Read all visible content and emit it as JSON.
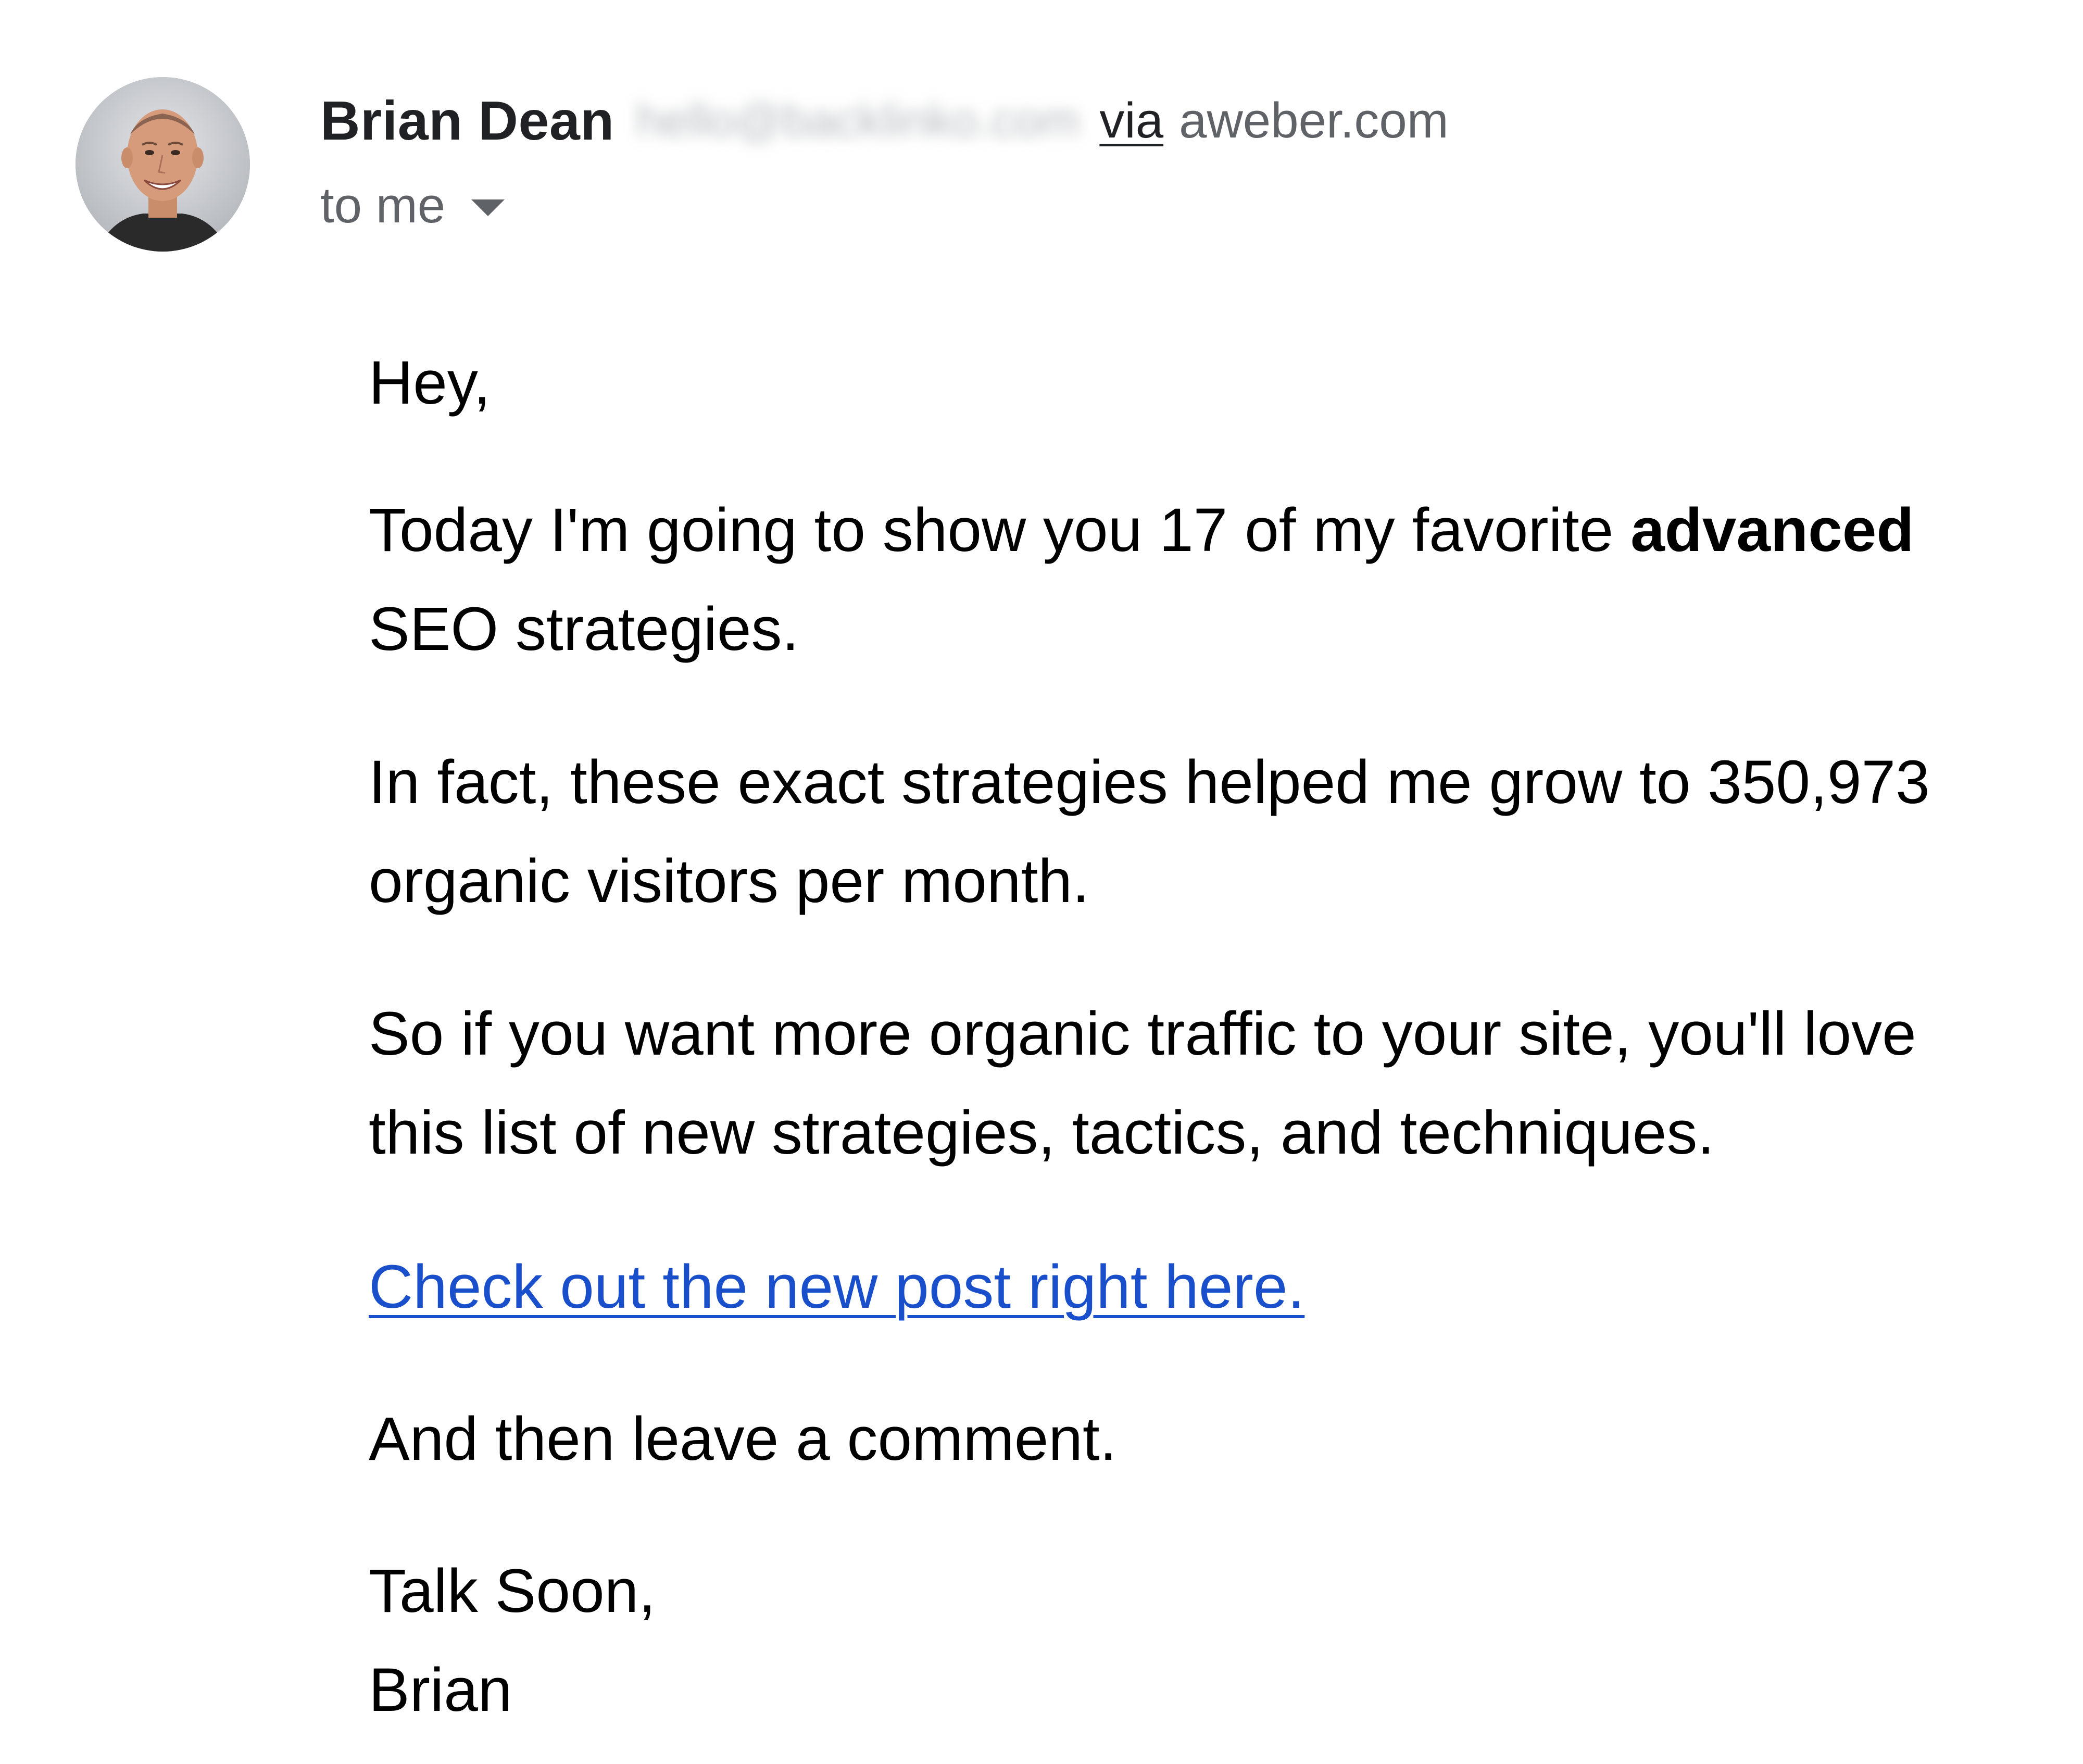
{
  "header": {
    "sender_name": "Brian Dean",
    "sender_email_redacted": "hello@backlinko.com",
    "via_label": "via",
    "via_domain": "aweber.com",
    "recipient": "to me",
    "avatar_icon": "avatar-photo",
    "dropdown_icon": "chevron-down-icon"
  },
  "body": {
    "greeting": "Hey,",
    "p1_before_bold": "Today I'm going to show you 17 of my favorite ",
    "p1_bold": "advanced",
    "p1_line2": "SEO strategies.",
    "p2_line1": "In fact, these exact strategies helped me grow to 350,973",
    "p2_line2": "organic visitors per month.",
    "p3_line1": "So if you want more organic traffic to your site, you'll love",
    "p3_line2": "this list of new strategies, tactics, and techniques.",
    "cta_link": "Check out the new post right here.",
    "p4": "And then leave a comment.",
    "signoff": "Talk Soon,",
    "signature": "Brian"
  },
  "colors": {
    "link": "#1a4fcc",
    "text": "#000000",
    "secondary_text": "#5f6368",
    "sender_name": "#202124"
  }
}
